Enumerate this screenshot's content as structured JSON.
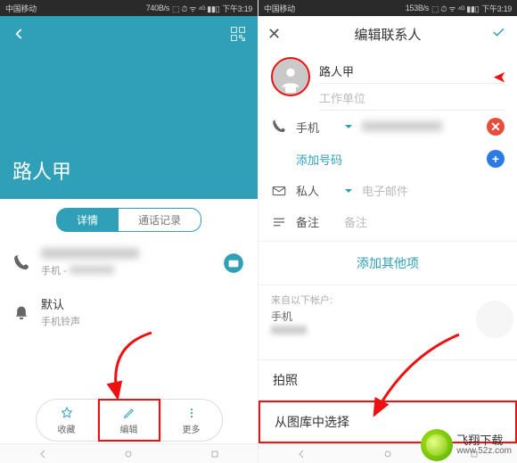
{
  "left": {
    "status": {
      "carrier": "中国移动",
      "speed": "740B/s",
      "icons": "⬚ ⏱ ᯤ ⁴ᴳ ▮▮▯",
      "time": "下午3:19"
    },
    "contact_name": "路人甲",
    "tabs": {
      "detail": "详情",
      "calllog": "通话记录"
    },
    "phone_row": {
      "label": "手机 -"
    },
    "ringtone_row": {
      "title": "默认",
      "sub": "手机铃声"
    },
    "bottom": {
      "fav": "收藏",
      "edit": "编辑",
      "more": "更多"
    }
  },
  "right": {
    "status": {
      "carrier": "中国移动",
      "speed": "153B/s",
      "icons": "⬚ ⏱ ᯤ ⁴ᴳ ▮▮▯",
      "time": "下午3:19"
    },
    "title": "编辑联系人",
    "name_value": "路人甲",
    "company_placeholder": "工作单位",
    "fields": {
      "phone": "手机",
      "add_number": "添加号码",
      "privacy": "私人",
      "email_placeholder": "电子邮件",
      "remark": "备注",
      "remark_placeholder": "备注"
    },
    "add_other": "添加其他项",
    "account": {
      "from": "来自以下帐户:",
      "type": "手机"
    },
    "sheet": {
      "camera": "拍照",
      "gallery": "从图库中选择"
    }
  },
  "watermark": {
    "name": "飞翔下载",
    "url": "www.52z.com"
  }
}
